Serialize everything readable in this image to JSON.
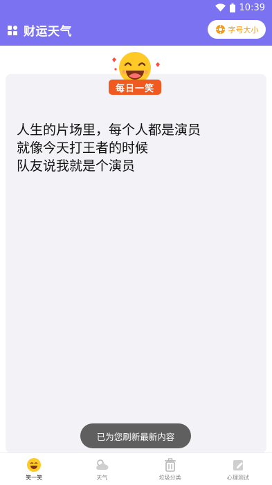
{
  "status_bar": {
    "time": "10:39"
  },
  "header": {
    "app_title": "财运天气",
    "font_size_button": "字号大小"
  },
  "joke": {
    "badge": "每日一笑",
    "text": "人生的片场里，每个人都是演员\n就像今天打王者的时候\n队友说我就是个演员"
  },
  "toast": {
    "message": "已为您刷新最新内容"
  },
  "bottom_nav": {
    "items": [
      {
        "label": "笑一笑",
        "icon": "smile-emoji-icon",
        "active": true
      },
      {
        "label": "天气",
        "icon": "weather-icon",
        "active": false
      },
      {
        "label": "垃圾分类",
        "icon": "trash-icon",
        "active": false
      },
      {
        "label": "心理测试",
        "icon": "edit-note-icon",
        "active": false
      }
    ]
  },
  "colors": {
    "header": "#7a72f0",
    "accent_orange": "#f39a16",
    "badge_red": "#ef5a20",
    "card_bg": "#f2f2f7"
  }
}
